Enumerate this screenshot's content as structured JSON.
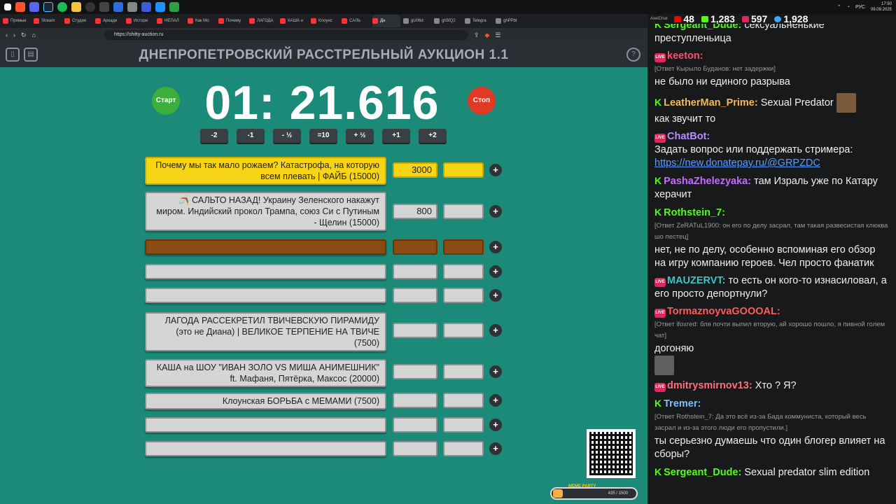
{
  "taskbar": {
    "clock_time": "17:50",
    "clock_date": "09.09.2025",
    "lang": "РУС"
  },
  "browser": {
    "tabs": [
      "Прямые",
      "Stream",
      "Студия",
      "Аркади",
      "Истори",
      "НЕПАЛ",
      "Как Мо",
      "Почему",
      "ЛАГОДА",
      "КАША н",
      "Клоунс",
      "САЛЬ",
      "Дн",
      "gU06d",
      "gh5fQ2",
      "Telegra",
      "ghPPbt"
    ],
    "url": "https://shitty-auction.ru"
  },
  "auction": {
    "title": "ДНЕПРОПЕТРОВСКИЙ РАССТРЕЛЬНЫЙ АУКЦИОН 1.1",
    "start_label": "Старт",
    "stop_label": "Стоп",
    "timer": "01: 21.616",
    "adjust_buttons": [
      "-2",
      "-1",
      "- ½",
      "=10",
      "+ ½",
      "+1",
      "+2"
    ],
    "lots": [
      {
        "name": "Почему мы так мало рожаем? Катастрофа, на которую всем плевать | ФАЙБ (15000)",
        "amount": "3000"
      },
      {
        "name": "🪃 САЛЬТО НАЗАД! Украину Зеленского накажут миром. Индийский прокол Трампа, союз Си с Путиным - Щелин (15000)",
        "amount": "800"
      },
      {
        "name": "",
        "amount": ""
      },
      {
        "name": "",
        "amount": ""
      },
      {
        "name": "",
        "amount": ""
      },
      {
        "name": "ЛАГОДА РАССЕКРЕТИЛ ТВИЧЕВСКУЮ ПИРАМИДУ (это не Диана) | ВЕЛИКОЕ ТЕРПЕНИЕ НА ТВИЧЕ (7500)",
        "amount": ""
      },
      {
        "name": "КАША на ШОУ \"ИВАН ЗОЛО VS МИША АНИМЕШНИК\" ft. Мафаня, Пятёрка, Максос (20000)",
        "amount": ""
      },
      {
        "name": "Клоунская БОРЬБА с МЕМАМИ (7500)",
        "amount": ""
      },
      {
        "name": "",
        "amount": ""
      },
      {
        "name": "",
        "amount": ""
      }
    ],
    "plus": "+",
    "meme_party": {
      "label": "MEME PARTY",
      "count": "435 / 1500"
    }
  },
  "chat": {
    "title": "AxelChat",
    "stats": {
      "youtube": "48",
      "kick": "1,283",
      "vk": "597",
      "viewers": "1,928"
    },
    "messages": [
      {
        "user": "Sergeant_Dude:",
        "text": "сексуальненькие преступленьица",
        "color": "#53fc18",
        "badge": "k"
      },
      {
        "user": "keeton:",
        "text": "не было ни единого разрыва",
        "reply": "[Ответ Кырыло Буданов: нет задержки]",
        "color": "#ff4f6a",
        "badge": "live"
      },
      {
        "user": "LeatherMan_Prime:",
        "text": "Sexual Predator",
        "extra": "как звучит то",
        "color": "#f5b85b",
        "badge": "k"
      },
      {
        "user": "ChatBot:",
        "text": "Задать вопрос или поддержать стримера:",
        "link": "https://new.donatepay.ru/@GRPZDC",
        "color": "#b98cff",
        "badge": "live"
      },
      {
        "user": "PashaZhelezyaka:",
        "text": "там Израль уже по Катару херачит",
        "color": "#c66bff",
        "badge": "k"
      },
      {
        "user": "Rothstein_7:",
        "text": "нет, не по делу, особенно вспоминая его обзор на игру компанию героев. Чел просто фанатик",
        "reply": "[Ответ ZeRATuL1900: он его по делу засрал, там такая развесистая клюква шо пестец]",
        "color": "#53fc18",
        "badge": "k"
      },
      {
        "user": "MAUZERVT:",
        "text": "то есть он кого-то изнасиловал, а его просто депортнули?",
        "color": "#3ec4c4",
        "badge": "live"
      },
      {
        "user": "TormaznoyvaGOOOAL:",
        "text": "догоняю",
        "reply": "[Ответ ifoxred: бля почти выпил вторую, ай хорошо пошло, я пивной голем чат]",
        "color": "#ff5c5c",
        "badge": "live"
      },
      {
        "user": "dmitrysmirnov13:",
        "text": "Хто ? Я?",
        "color": "#ff6f7d",
        "badge": "live"
      },
      {
        "user": "Tremer:",
        "text": "ты серьезно думаешь что один блогер влияет на сборы?",
        "reply": "[Ответ Rothstein_7: Да это всё из-за Бада коммуниста, который весь засрал и из-за этого люди его пропустили.]",
        "color": "#7fbfff",
        "badge": "k"
      },
      {
        "user": "Sergeant_Dude:",
        "text": "Sexual predator slim edition",
        "color": "#53fc18",
        "badge": "k"
      }
    ]
  }
}
